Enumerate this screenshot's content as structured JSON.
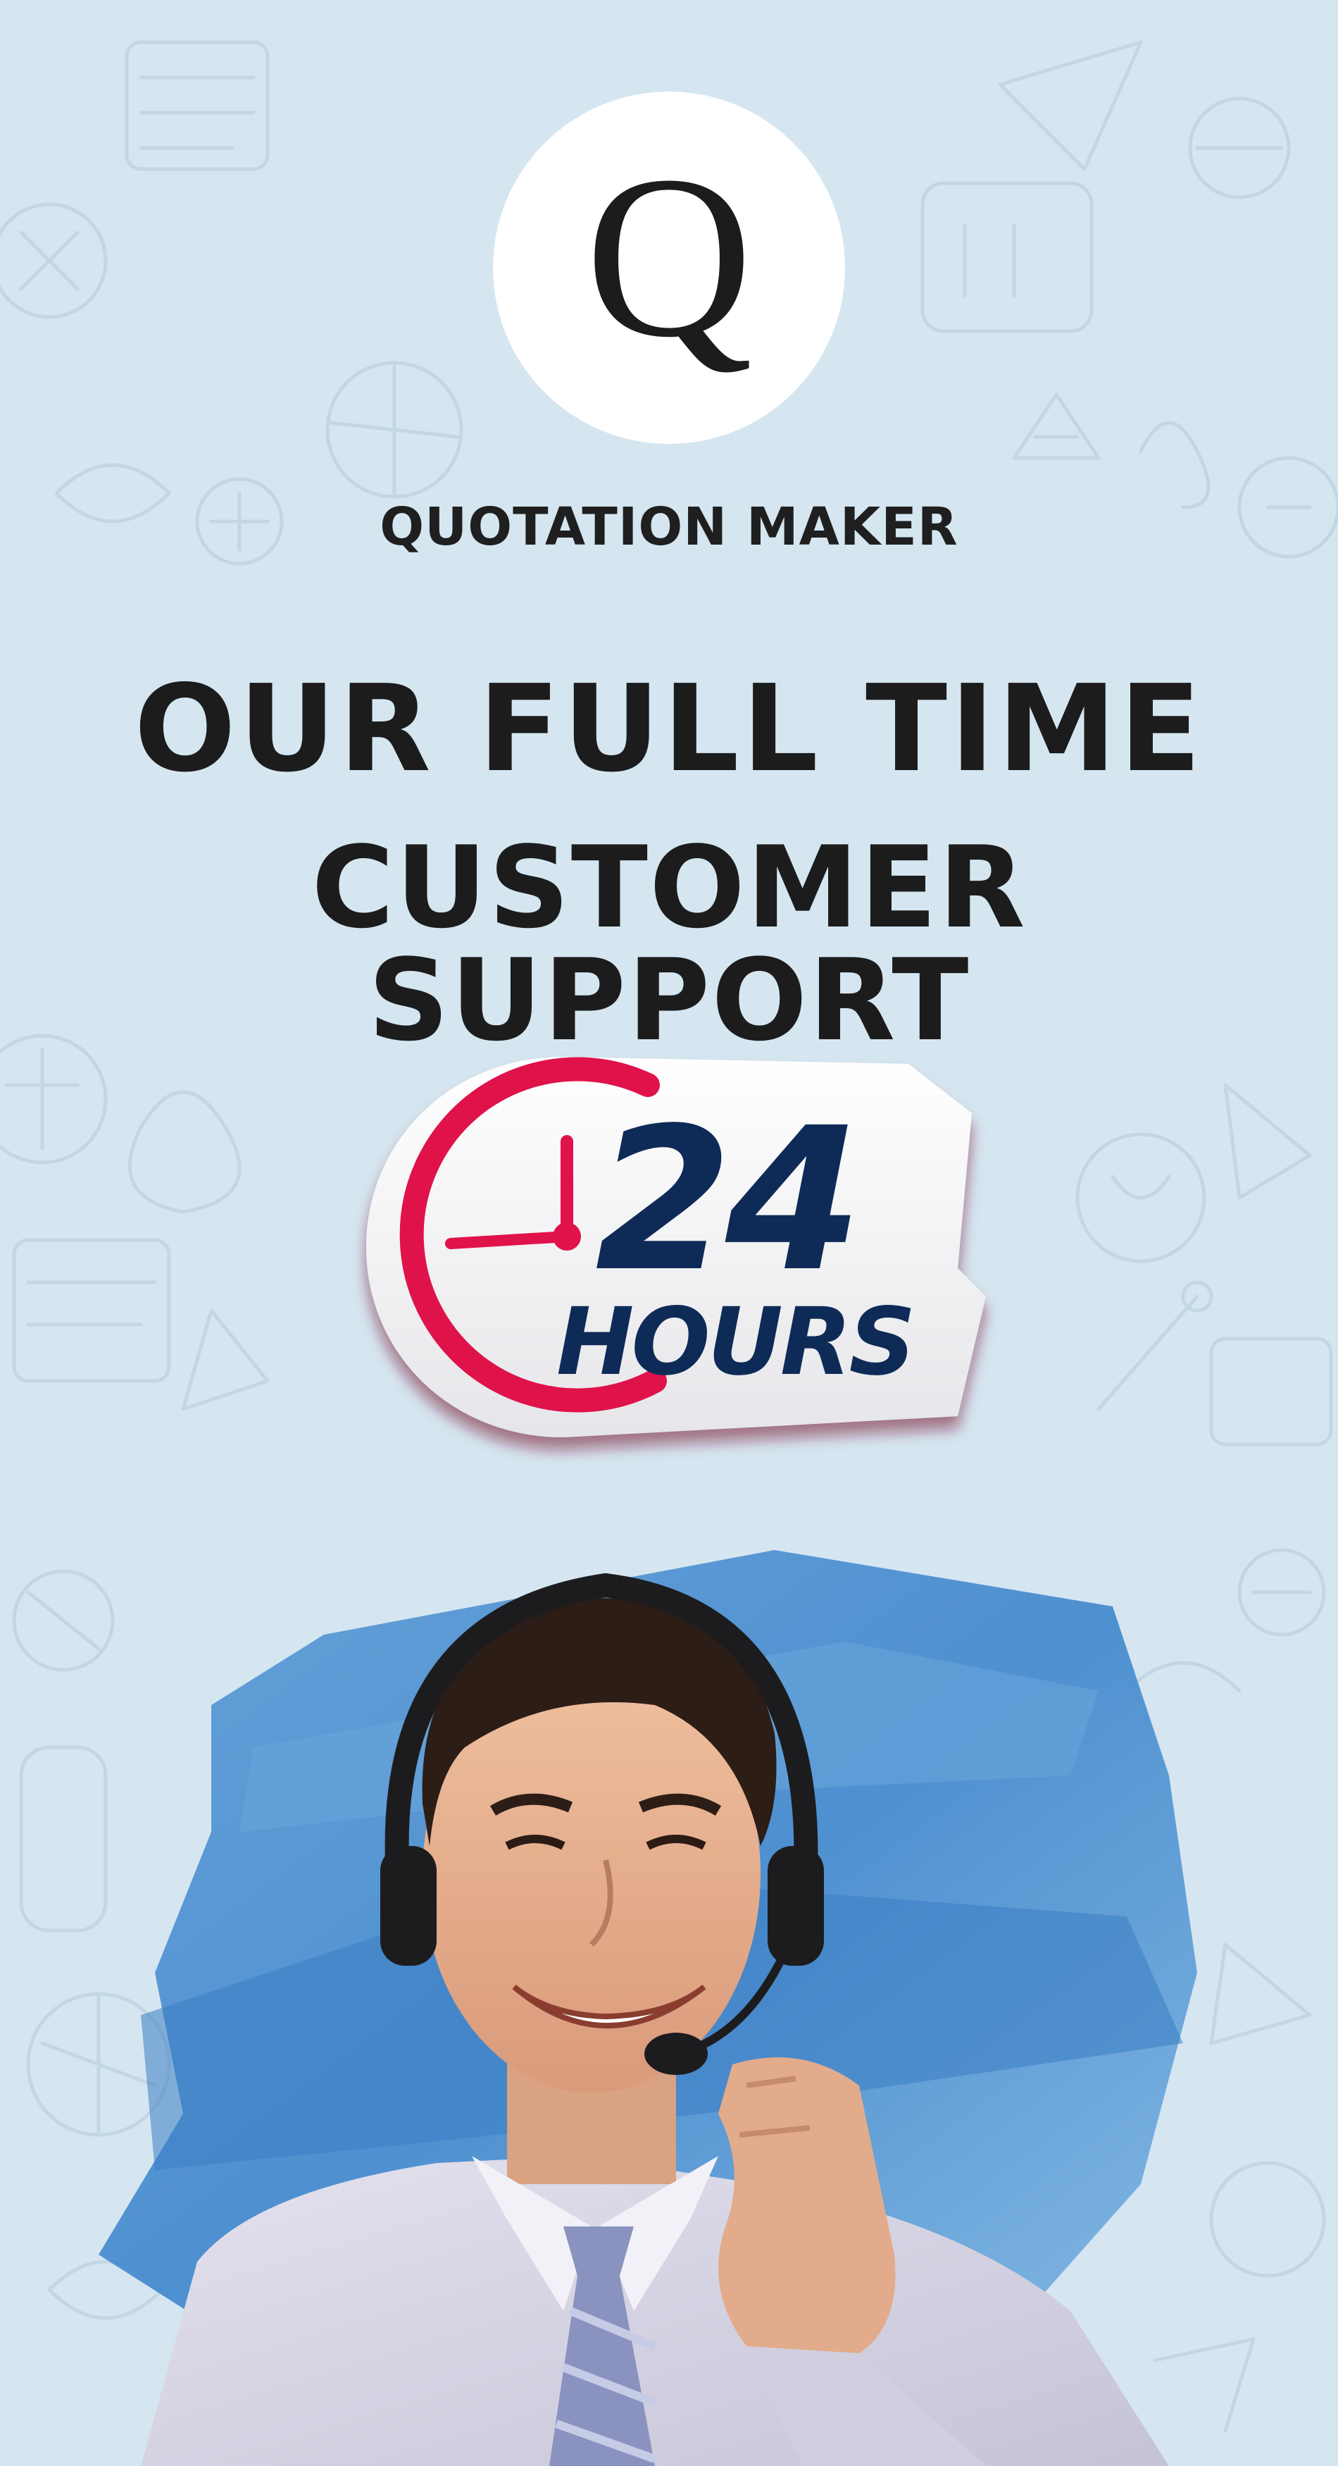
{
  "brand": {
    "logo_letter": "Q",
    "name": "QUOTATION MAKER"
  },
  "headline": {
    "line1": "OUR FULL TIME",
    "line2": "CUSTOMER SUPPORT"
  },
  "badge": {
    "number": "24",
    "unit": "HOURS",
    "colors": {
      "clock": "#e0124a",
      "text": "#0e2b57"
    }
  },
  "hero": {
    "subject": "support-agent-with-headset"
  }
}
